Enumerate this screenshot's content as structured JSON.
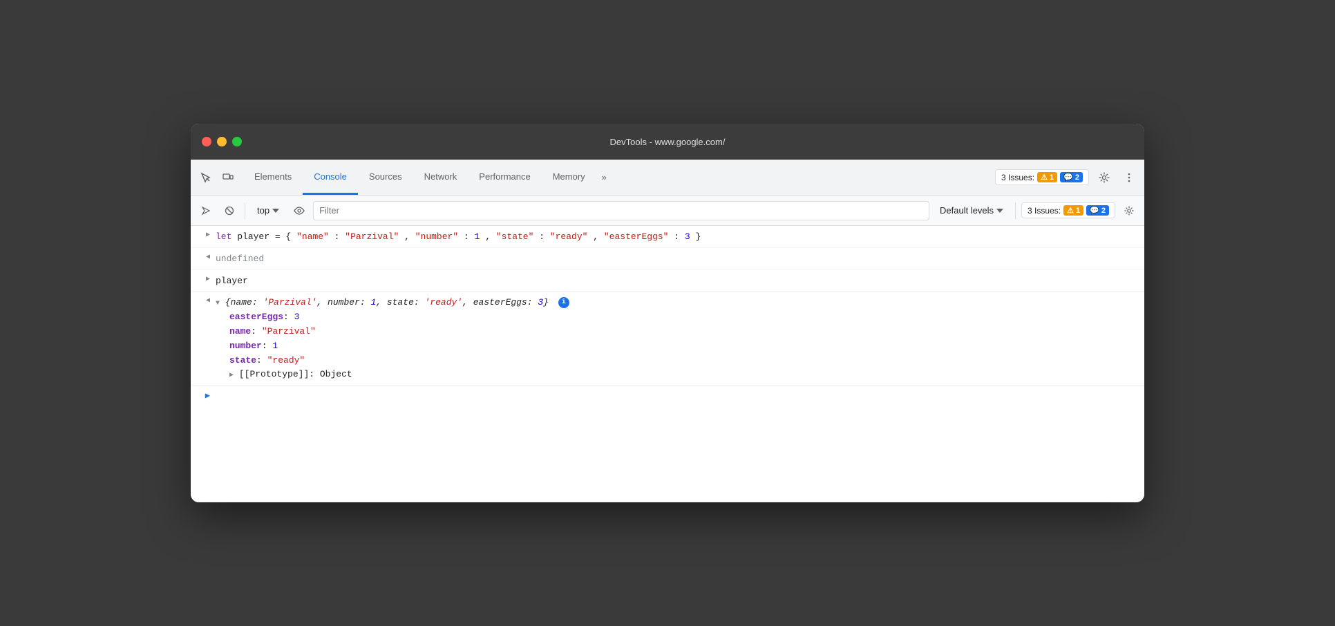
{
  "window": {
    "title": "DevTools - www.google.com/"
  },
  "tabs": [
    {
      "label": "Elements",
      "active": false
    },
    {
      "label": "Console",
      "active": true
    },
    {
      "label": "Sources",
      "active": false
    },
    {
      "label": "Network",
      "active": false
    },
    {
      "label": "Performance",
      "active": false
    },
    {
      "label": "Memory",
      "active": false
    }
  ],
  "tabs_overflow": "»",
  "issues_label": "1",
  "issues_count_warn": "1",
  "issues_count_info": "2",
  "issues_text": "3 Issues:",
  "console_toolbar": {
    "context_label": "top",
    "filter_placeholder": "Filter",
    "default_levels_label": "Default levels"
  },
  "console_lines": [
    {
      "type": "input",
      "html": "<span class='kw'>let</span> <span class='var-name'>player</span> = { <span class='str'>\"name\"</span>: <span class='str'>\"Parzival\"</span>, <span class='str'>\"number\"</span>: <span class='num'>1</span>, <span class='str'>\"state\"</span>: <span class='str'>\"ready\"</span>, <span class='str'>\"easterEggs\"</span>: <span class='num'>3</span> }"
    },
    {
      "type": "output-undefined",
      "html": "<span class='gray'>undefined</span>"
    },
    {
      "type": "input",
      "html": "<span class='var-name'>player</span>"
    },
    {
      "type": "output-object",
      "expanded": true,
      "preview": "<span class='obj-preview'>▼ <span style='font-style:italic'>{name: <span class='str-italic'>'Parzival'</span>, number: <span class='num-italic'>1</span>, state: <span class='str-italic'>'ready'</span>, easterEggs: <span class='num-italic'>3</span>}</span></span>",
      "properties": [
        {
          "key": "easterEggs",
          "value": "<span class='num'>3</span>"
        },
        {
          "key": "name",
          "value": "<span class='str'>\"Parzival\"</span>"
        },
        {
          "key": "number",
          "value": "<span class='num'>1</span>"
        },
        {
          "key": "state",
          "value": "<span class='str'>\"ready\"</span>"
        }
      ],
      "prototype": "[[Prototype]]: Object"
    }
  ]
}
